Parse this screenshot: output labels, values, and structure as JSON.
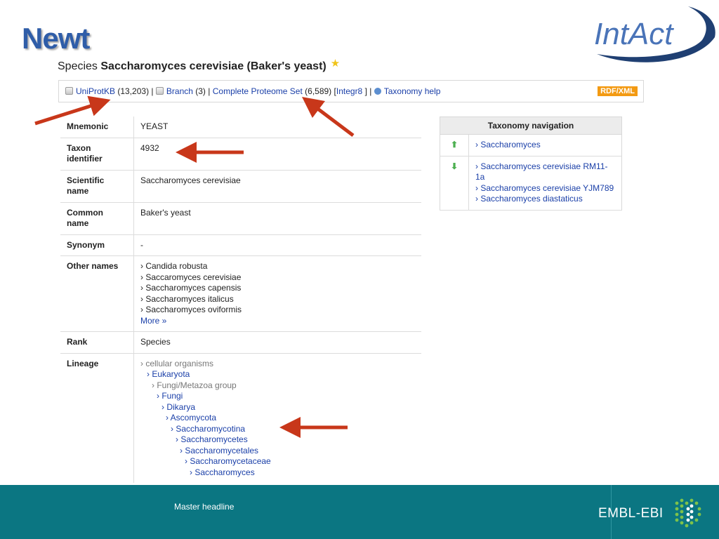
{
  "slide": {
    "title": "Newt",
    "logo_text": "IntAct",
    "footer_headline": "Master headline",
    "footer_logo_text": "EMBL-EBI"
  },
  "heading": {
    "prefix": "Species",
    "name": "Saccharomyces cerevisiae (Baker's yeast)",
    "star_icon": "star-icon"
  },
  "linkbar": {
    "uniprot_label": "UniProtKB",
    "uniprot_count": "(13,203)",
    "branch_label": "Branch",
    "branch_count": "(3)",
    "proteome_label": "Complete Proteome Set",
    "proteome_count": "(6,589)",
    "integr8_label": "Integr8",
    "help_label": "Taxonomy help",
    "rdf_label": "RDF/XML",
    "sep1": "|",
    "sep2": "|",
    "bracket_open": "[",
    "bracket_close": "]",
    "sep3": "|"
  },
  "info": {
    "mnemonic_key": "Mnemonic",
    "mnemonic_val": "YEAST",
    "taxon_key": "Taxon identifier",
    "taxon_val": "4932",
    "scientific_key": "Scientific name",
    "scientific_val": "Saccharomyces cerevisiae",
    "common_key": "Common name",
    "common_val": "Baker's yeast",
    "synonym_key": "Synonym",
    "synonym_val": "-",
    "other_key": "Other names",
    "other_names": [
      "› Candida robusta",
      "› Saccaromyces cerevisiae",
      "› Saccharomyces capensis",
      "› Saccharomyces italicus",
      "› Saccharomyces oviformis"
    ],
    "more_label": "More »",
    "rank_key": "Rank",
    "rank_val": "Species",
    "lineage_key": "Lineage",
    "lineage": [
      "› cellular organisms",
      "› Eukaryota",
      "› Fungi/Metazoa group",
      "› Fungi",
      "› Dikarya",
      "› Ascomycota",
      "› Saccharomycotina",
      "› Saccharomycetes",
      "› Saccharomycetales",
      "› Saccharomycetaceae",
      "› Saccharomyces"
    ]
  },
  "nav": {
    "header": "Taxonomy navigation",
    "up_icon": "arrow-up-icon",
    "down_icon": "arrow-down-icon",
    "parent": "› Saccharomyces",
    "children": [
      "› Saccharomyces cerevisiae RM11-1a",
      "› Saccharomyces cerevisiae YJM789",
      "› Saccharomyces diastaticus"
    ]
  },
  "colors": {
    "title": "#2f5da8",
    "link": "#1a3fa8",
    "arrow": "#c8371a",
    "footer": "#0b7682",
    "rdf_badge": "#f39a12"
  }
}
